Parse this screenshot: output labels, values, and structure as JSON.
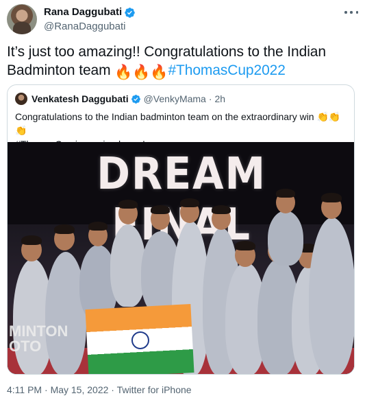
{
  "author": {
    "display_name": "Rana Daggubati",
    "handle": "@RanaDaggubati"
  },
  "tweet": {
    "text_line1": "It’s just too amazing!! Congratulations to the Indian",
    "text_line2": "Badminton team",
    "emoji": "🔥🔥🔥",
    "hashtag": "#ThomasCup2022"
  },
  "quoted": {
    "display_name": "Venkatesh Daggubati",
    "handle": "@VenkyMama",
    "separator": "·",
    "time": "2h",
    "text_line1": "Congratulations to the Indian badminton team on the extraordinary win",
    "clap_emoji": "👏👏👏",
    "text_line2": "#ThomasCup is coming home!",
    "image": {
      "headline": "DREAM FINAL",
      "watermark": "MINTON OTO"
    }
  },
  "footer": {
    "time": "4:11 PM",
    "sep1": "·",
    "date": "May 15, 2022",
    "sep2": "·",
    "source": "Twitter for iPhone"
  },
  "colors": {
    "link": "#1d9bf0",
    "verified": "#1d9bf0",
    "secondary_text": "#536471",
    "border": "#cfd9de"
  },
  "icons": [
    "verified-badge-icon",
    "more-options-icon"
  ]
}
